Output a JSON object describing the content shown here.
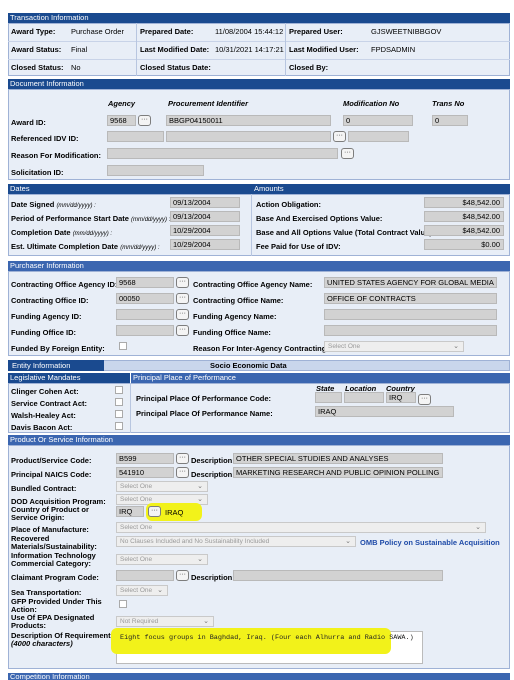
{
  "transaction": {
    "header": "Transaction Information",
    "award_type_label": "Award Type:",
    "award_type": "Purchase Order",
    "prepared_date_label": "Prepared Date:",
    "prepared_date": "11/08/2004 15:44:12",
    "prepared_user_label": "Prepared User:",
    "prepared_user": "GJSWEETNIBBGOV",
    "award_status_label": "Award Status:",
    "award_status": "Final",
    "last_modified_date_label": "Last Modified Date:",
    "last_modified_date": "10/31/2021 14:17:21",
    "last_modified_by_label": "Last Modified User:",
    "last_modified_by": "FPDSADMIN",
    "closed_status_label": "Closed Status:",
    "closed_status": "No",
    "closed_status_date_label": "Closed Status Date:",
    "closed_by_label": "Closed By:"
  },
  "document": {
    "header": "Document Information",
    "col_agency": "Agency",
    "col_proc_id": "Procurement Identifier",
    "col_mod": "Modification No",
    "col_trans": "Trans No",
    "award_id_label": "Award ID:",
    "agency": "9568",
    "proc_id": "BBGP04150011",
    "mod_no": "0",
    "trans_no": "0",
    "ref_idv_label": "Referenced IDV ID:",
    "reason_label": "Reason For Modification:",
    "solicitation_label": "Solicitation ID:"
  },
  "dates": {
    "header": "Dates",
    "signed_label": "Date Signed",
    "signed": "09/13/2004",
    "pop_start_label": "Period of Performance Start Date",
    "pop_start": "09/13/2004",
    "completion_label": "Completion Date",
    "completion": "10/29/2004",
    "ult_completion_label": "Est. Ultimate Completion Date",
    "ult_completion": "10/29/2004",
    "fmt": "(mm/dd/yyyy) :"
  },
  "amounts": {
    "header": "Amounts",
    "action_obligation_label": "Action Obligation:",
    "action_obligation": "$48,542.00",
    "base_exercised_label": "Base And Exercised Options Value:",
    "base_exercised": "$48,542.00",
    "base_all_label": "Base and All Options Value (Total Contract Value):",
    "base_all": "$48,542.00",
    "fee_label": "Fee Paid for Use of IDV:",
    "fee": "$0.00"
  },
  "purchaser": {
    "header": "Purchaser Information",
    "co_agency_id_label": "Contracting Office Agency ID:",
    "co_agency_id": "9568",
    "co_agency_name_label": "Contracting Office Agency Name:",
    "co_agency_name": "UNITED STATES AGENCY FOR GLOBAL MEDIA",
    "co_office_id_label": "Contracting Office ID:",
    "co_office_id": "00050",
    "co_office_name_label": "Contracting Office Name:",
    "co_office_name": "OFFICE OF CONTRACTS",
    "funding_agency_id_label": "Funding Agency ID:",
    "funding_agency_name_label": "Funding Agency Name:",
    "funding_office_id_label": "Funding Office ID:",
    "funding_office_name_label": "Funding Office Name:",
    "foreign_label": "Funded By Foreign Entity:",
    "inter_agency_label": "Reason For Inter-Agency Contracting:",
    "inter_agency_value": "Select One"
  },
  "tabs": {
    "entity": "Entity Information",
    "socio": "Socio Economic Data"
  },
  "legislative": {
    "header": "Legislative Mandates",
    "clinger": "Clinger Cohen Act:",
    "service": "Service Contract Act:",
    "walsh": "Walsh-Healey Act:",
    "davis": "Davis Bacon Act:"
  },
  "place": {
    "header": "Principal Place of Performance",
    "col_state": "State",
    "col_location": "Location",
    "col_country": "Country",
    "code_label": "Principal Place Of Performance Code:",
    "country_code": "IRQ",
    "name_label": "Principal Place Of Performance Name:",
    "name": "IRAQ"
  },
  "product": {
    "header": "Product Or Service Information",
    "psc_label": "Product/Service Code:",
    "psc": "B599",
    "desc_label": "Description:",
    "psc_desc": "OTHER SPECIAL STUDIES AND ANALYSES",
    "naics_label": "Principal NAICS Code:",
    "naics": "541910",
    "naics_desc": "MARKETING RESEARCH AND PUBLIC OPINION POLLING",
    "bundled_label": "Bundled Contract:",
    "bundled": "Select One",
    "dod_label": "DOD Acquisition Program:",
    "dod": "Select One",
    "country_origin_label": "Country of Product or Service Origin:",
    "country_origin_code": "IRQ",
    "country_origin_name": "IRAQ",
    "manufacture_label": "Place of Manufacture:",
    "manufacture": "Select One",
    "recovered_label": "Recovered Materials/Sustainability:",
    "recovered": "No Clauses Included and No Sustainability Included",
    "omb_link": "OMB Policy on Sustainable Acquisition",
    "it_label": "Information Technology Commercial Category:",
    "it": "Select One",
    "claimant_label": "Claimant Program Code:",
    "sea_label": "Sea Transportation:",
    "sea": "Select One",
    "gfp_label": "GFP Provided Under This Action:",
    "epa_label": "Use Of EPA Designated Products:",
    "epa": "Not Required",
    "req_label": "Description Of Requirement:",
    "req_sub": "(4000 characters)",
    "req_text": "Eight focus groups in Baghdad, Iraq.  (Four each Alhurra and Radio SAWA.)"
  },
  "competition": {
    "header": "Competition Information"
  },
  "ellipsis": "···",
  "colors": {
    "header_bg": "#1a4a8f",
    "panel_bg": "#e8eef7",
    "highlight": "#f2f21a",
    "link": "#1f4ba8"
  }
}
